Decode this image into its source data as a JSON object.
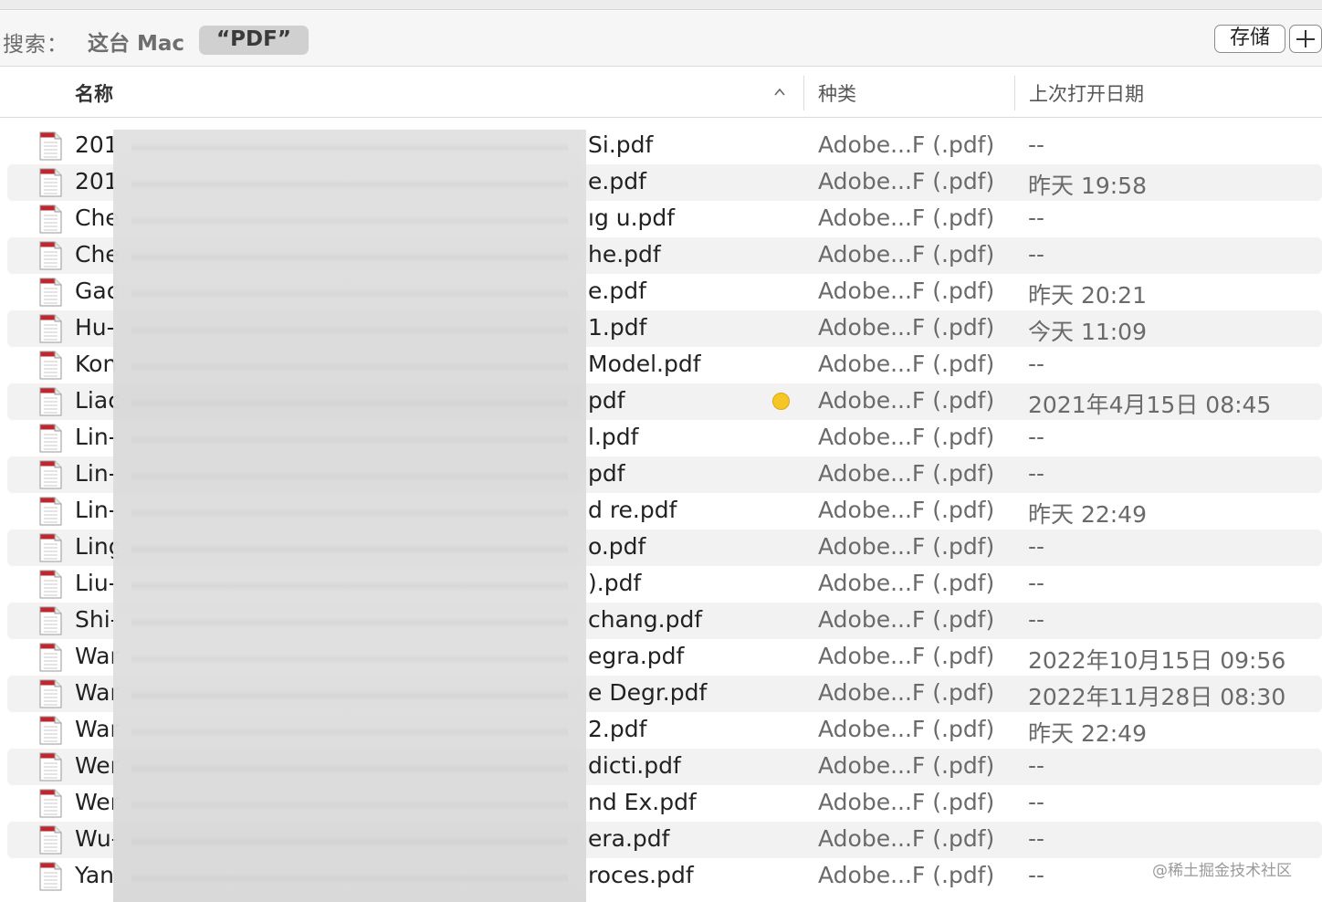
{
  "search": {
    "label": "搜索：",
    "scope_this_mac": "这台 Mac",
    "scope_selected": "“PDF”",
    "save_label": "存储",
    "add_icon": "plus-icon"
  },
  "columns": {
    "name": "名称",
    "kind": "种类",
    "last_opened": "上次打开日期",
    "sort_indicator": "chevron-up-icon"
  },
  "colors": {
    "tag_yellow": "#f5c626",
    "row_alt": "#f2f2f2",
    "pdf_icon_red": "#c0262d"
  },
  "files": [
    {
      "name_head": "201",
      "name_tail": "Si.pdf",
      "kind": "Adobe...F (.pdf)",
      "last_opened": "--",
      "tag": ""
    },
    {
      "name_head": "201",
      "name_tail": "e.pdf",
      "kind": "Adobe...F (.pdf)",
      "last_opened": "昨天 19:58",
      "tag": ""
    },
    {
      "name_head": "Che",
      "name_tail": "ıg u.pdf",
      "kind": "Adobe...F (.pdf)",
      "last_opened": "--",
      "tag": ""
    },
    {
      "name_head": "Che",
      "name_tail": "he.pdf",
      "kind": "Adobe...F (.pdf)",
      "last_opened": "--",
      "tag": ""
    },
    {
      "name_head": "Gac",
      "name_tail": "e.pdf",
      "kind": "Adobe...F (.pdf)",
      "last_opened": "昨天 20:21",
      "tag": ""
    },
    {
      "name_head": "Hu-",
      "name_tail": "1.pdf",
      "kind": "Adobe...F (.pdf)",
      "last_opened": "今天 11:09",
      "tag": ""
    },
    {
      "name_head": "Kon",
      "name_tail": "Model.pdf",
      "kind": "Adobe...F (.pdf)",
      "last_opened": "--",
      "tag": ""
    },
    {
      "name_head": "Liac",
      "name_tail": "pdf",
      "kind": "Adobe...F (.pdf)",
      "last_opened": "2021年4月15日 08:45",
      "tag": "yellow"
    },
    {
      "name_head": "Lin-",
      "name_tail": "l.pdf",
      "kind": "Adobe...F (.pdf)",
      "last_opened": "--",
      "tag": ""
    },
    {
      "name_head": "Lin-",
      "name_tail": "pdf",
      "kind": "Adobe...F (.pdf)",
      "last_opened": "--",
      "tag": ""
    },
    {
      "name_head": "Lin-",
      "name_tail": "d re.pdf",
      "kind": "Adobe...F (.pdf)",
      "last_opened": "昨天 22:49",
      "tag": ""
    },
    {
      "name_head": "Ling",
      "name_tail": "o.pdf",
      "kind": "Adobe...F (.pdf)",
      "last_opened": "--",
      "tag": ""
    },
    {
      "name_head": "Liu-",
      "name_tail": ").pdf",
      "kind": "Adobe...F (.pdf)",
      "last_opened": "--",
      "tag": ""
    },
    {
      "name_head": "Shi-",
      "name_tail": "chang.pdf",
      "kind": "Adobe...F (.pdf)",
      "last_opened": "--",
      "tag": ""
    },
    {
      "name_head": "Wan",
      "name_tail": "egra.pdf",
      "kind": "Adobe...F (.pdf)",
      "last_opened": "2022年10月15日 09:56",
      "tag": ""
    },
    {
      "name_head": "Wan",
      "name_tail": "e Degr.pdf",
      "kind": "Adobe...F (.pdf)",
      "last_opened": "2022年11月28日 08:30",
      "tag": ""
    },
    {
      "name_head": "Wan",
      "name_tail": "2.pdf",
      "kind": "Adobe...F (.pdf)",
      "last_opened": "昨天 22:49",
      "tag": ""
    },
    {
      "name_head": "Wer",
      "name_tail": "dicti.pdf",
      "kind": "Adobe...F (.pdf)",
      "last_opened": "--",
      "tag": ""
    },
    {
      "name_head": "Wer",
      "name_tail": "nd Ex.pdf",
      "kind": "Adobe...F (.pdf)",
      "last_opened": "--",
      "tag": ""
    },
    {
      "name_head": "Wu-",
      "name_tail": "era.pdf",
      "kind": "Adobe...F (.pdf)",
      "last_opened": "--",
      "tag": ""
    },
    {
      "name_head": "Yan",
      "name_tail": "roces.pdf",
      "kind": "Adobe...F (.pdf)",
      "last_opened": "--",
      "tag": ""
    }
  ],
  "watermark": "@稀土掘金技术社区"
}
